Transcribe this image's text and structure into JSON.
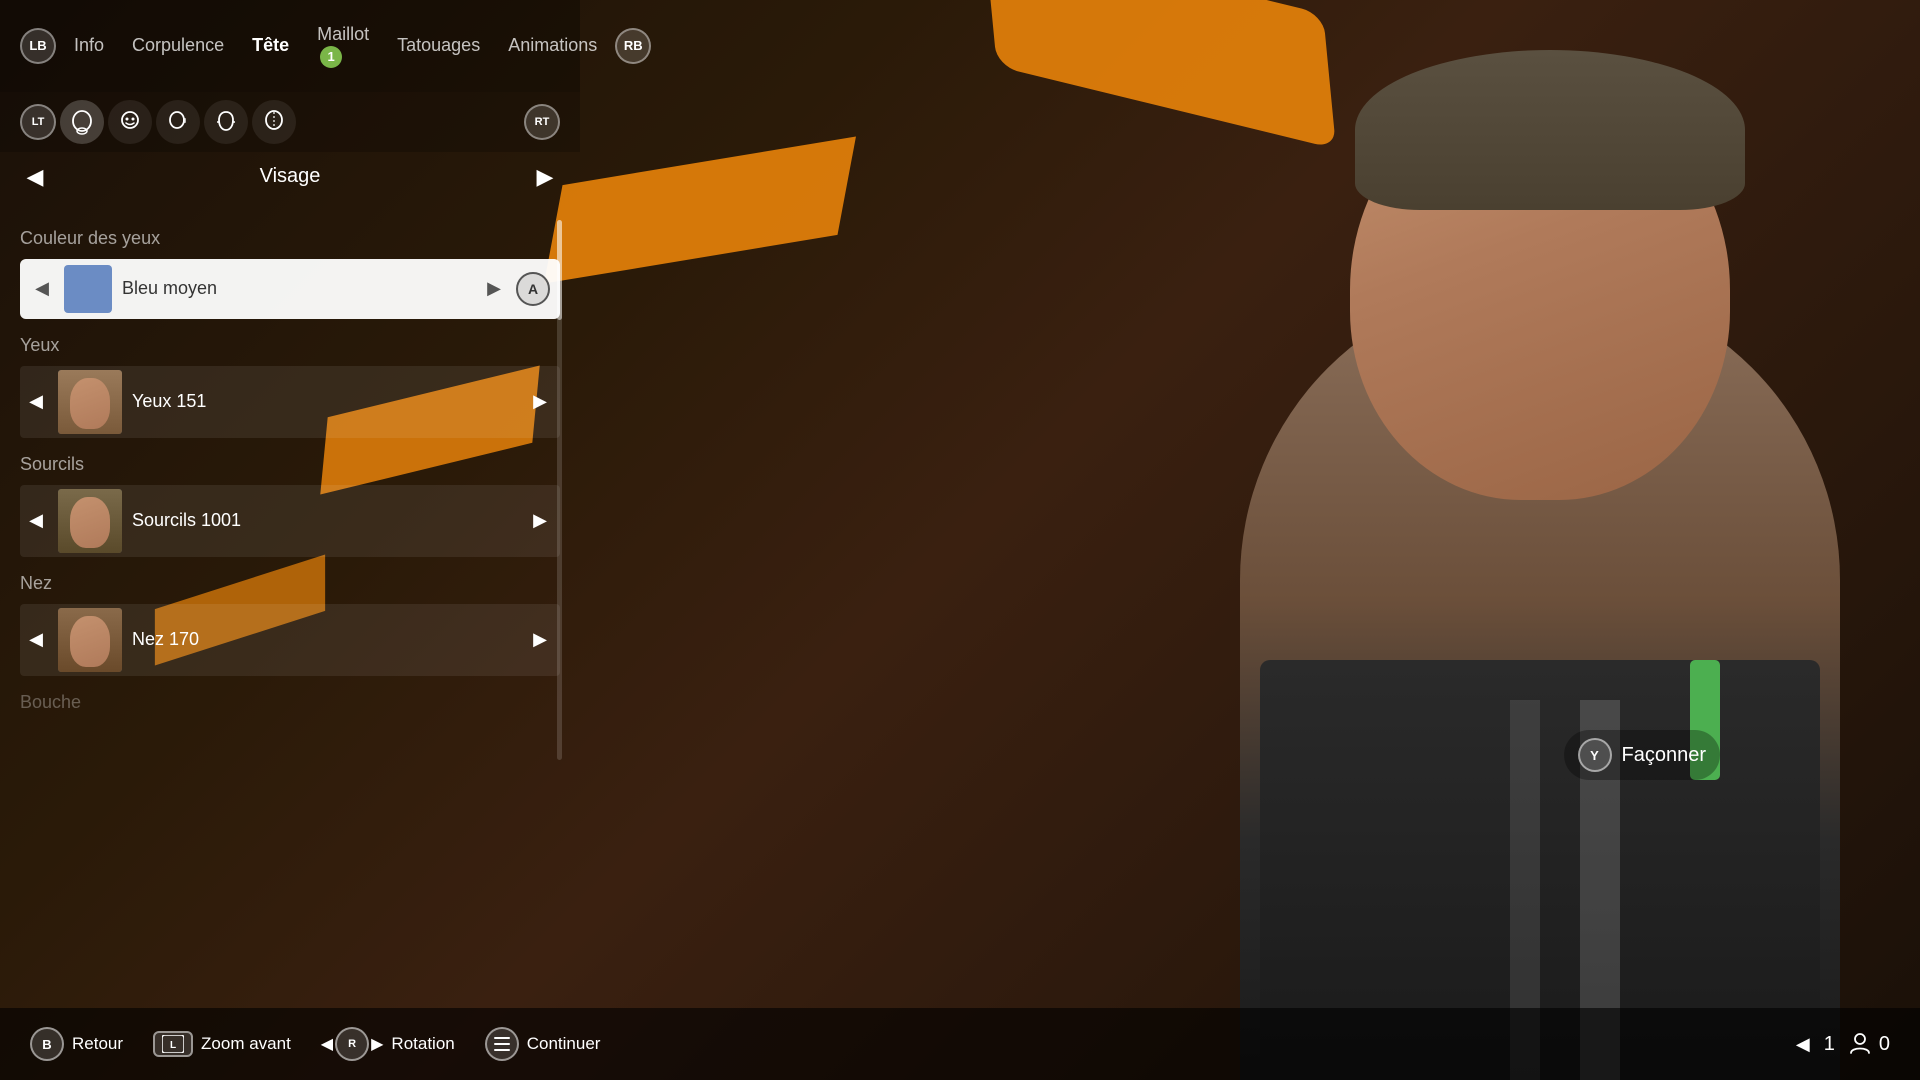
{
  "background": {
    "color": "#1a1008"
  },
  "topNav": {
    "lb": "LB",
    "rb": "RB",
    "items": [
      {
        "id": "info",
        "label": "Info",
        "active": false
      },
      {
        "id": "corpulence",
        "label": "Corpulence",
        "active": false
      },
      {
        "id": "tete",
        "label": "Tête",
        "active": true
      },
      {
        "id": "maillot",
        "label": "Maillot",
        "active": false,
        "badge": "1"
      },
      {
        "id": "tatouages",
        "label": "Tatouages",
        "active": false
      },
      {
        "id": "animations",
        "label": "Animations",
        "active": false
      }
    ]
  },
  "subNav": {
    "lt": "LT",
    "rt": "RT"
  },
  "sectionNav": {
    "title": "Visage",
    "leftArrow": "◀",
    "rightArrow": "▶"
  },
  "options": {
    "eyeColorLabel": "Couleur des yeux",
    "eyeColorValue": "Bleu moyen",
    "eyeColorSwatchColor": "#6b8cc4",
    "eyesLabel": "Yeux",
    "eyesValue": "Yeux 151",
    "eyebrowsLabel": "Sourcils",
    "eyebrowsValue": "Sourcils 1001",
    "noseLabel": "Nez",
    "noseValue": "Nez 170",
    "mouthLabel": "Bouche"
  },
  "faconner": {
    "buttonLabel": "Y",
    "label": "Façonner"
  },
  "bottomBar": {
    "backButton": "B",
    "backLabel": "Retour",
    "zoomLabel": "Zoom avant",
    "rotationLabel": "Rotation",
    "continueLabel": "Continuer"
  },
  "bottomCounters": {
    "count1": "1",
    "count2": "0"
  }
}
